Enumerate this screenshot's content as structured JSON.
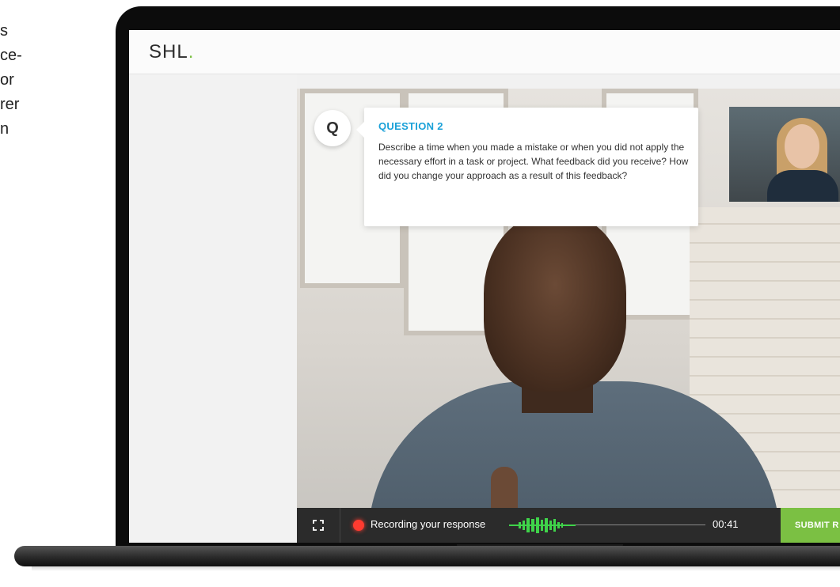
{
  "side_text": [
    "s",
    "ce-",
    "or",
    "rer",
    "n"
  ],
  "app": {
    "logo": "SHL",
    "logo_dot": ".",
    "accent_color": "#7bc043"
  },
  "question": {
    "badge": "Q",
    "title": "QUESTION 2",
    "text": "Describe a time when you made a mistake or when you did not apply the necessary effort in a task or project. What feedback did you receive? How did you change your approach as a result of this feedback?",
    "title_color": "#1ba1d8"
  },
  "controls": {
    "fullscreen_icon": "fullscreen-icon",
    "recording_label": "Recording your response",
    "timer": "00:41",
    "submit_label": "SUBMIT R",
    "record_color": "#ff3b30"
  }
}
